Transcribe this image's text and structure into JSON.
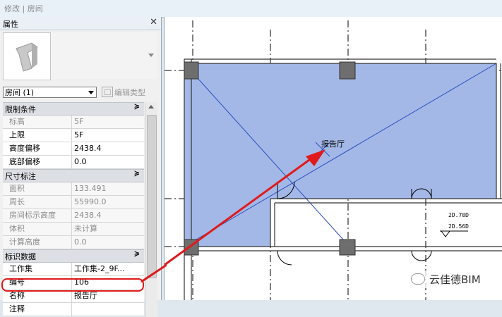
{
  "window": {
    "title": "修改 | 房间"
  },
  "properties_panel": {
    "title": "属性",
    "close_glyph": "✕",
    "type_selector": "房间 (1)",
    "edit_type_label": "编辑类型",
    "sections": [
      {
        "title": "限制条件",
        "collapse": "≽",
        "rows": [
          {
            "key": "标高",
            "value": "5F",
            "dim": true
          },
          {
            "key": "上限",
            "value": "5F",
            "dim": false
          },
          {
            "key": "高度偏移",
            "value": "2438.4",
            "dim": false
          },
          {
            "key": "底部偏移",
            "value": "0.0",
            "dim": false
          }
        ]
      },
      {
        "title": "尺寸标注",
        "collapse": "≽",
        "rows": [
          {
            "key": "面积",
            "value": "133.491",
            "dim": true
          },
          {
            "key": "周长",
            "value": "55990.0",
            "dim": true
          },
          {
            "key": "房间标示高度",
            "value": "2438.4",
            "dim": true
          },
          {
            "key": "体积",
            "value": "未计算",
            "dim": true
          },
          {
            "key": "计算高度",
            "value": "0.0",
            "dim": true
          }
        ]
      },
      {
        "title": "标识数据",
        "collapse": "≽",
        "rows": [
          {
            "key": "工作集",
            "value": "工作集-2_9F...",
            "dim": false
          },
          {
            "key": "编号",
            "value": "106",
            "dim": false
          },
          {
            "key": "名称",
            "value": "报告厅",
            "dim": false
          },
          {
            "key": "注释",
            "value": "",
            "dim": false
          }
        ]
      }
    ]
  },
  "drawing": {
    "room_label": "报告厅",
    "level_tag_top": "2D.70D",
    "level_tag_bottom": "2D.56D"
  },
  "colors": {
    "room_fill": "#a3b8e6",
    "room_edge": "#3a5fc8",
    "annotation_red": "#e01a1a"
  },
  "watermark": {
    "text": "云佳德BIM"
  }
}
